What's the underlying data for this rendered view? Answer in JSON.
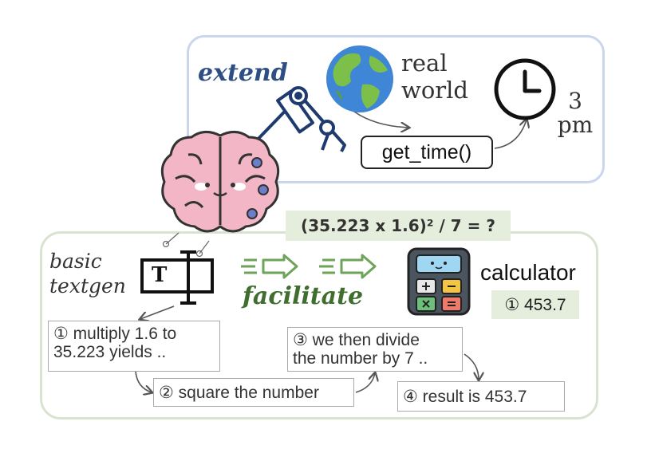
{
  "top_panel": {
    "label": "extend",
    "world_label_line1": "real",
    "world_label_line2": "world",
    "function_call": "get_time()",
    "result_line1": "3",
    "result_line2": "pm"
  },
  "bottom_panel": {
    "textgen_label_line1": "basic",
    "textgen_label_line2": "textgen",
    "textgen_icon_letter": "T",
    "label": "facilitate",
    "equation": "(35.223 x 1.6)² / 7 = ?",
    "tool_label": "calculator",
    "tool_result": "① 453.7",
    "steps": [
      {
        "line1": "① multiply 1.6 to",
        "line2": "35.223 yields .."
      },
      {
        "line1": "② square the number"
      },
      {
        "line1": "③ we then divide",
        "line2": "the number by 7 .."
      },
      {
        "line1": "④ result is 453.7"
      }
    ]
  },
  "colors": {
    "top_border": "#c9d6ee",
    "bottom_border": "#d9e3cf",
    "extend_text": "#2e4f86",
    "facilitate_text": "#3f6e2f",
    "highlight_bg": "#e5eedd",
    "brain_pink": "#f2b6c6"
  },
  "icons": [
    "brain-icon",
    "robot-arm-icon",
    "globe-icon",
    "clock-icon",
    "textgen-icon",
    "arrow-icon",
    "calculator-icon"
  ]
}
